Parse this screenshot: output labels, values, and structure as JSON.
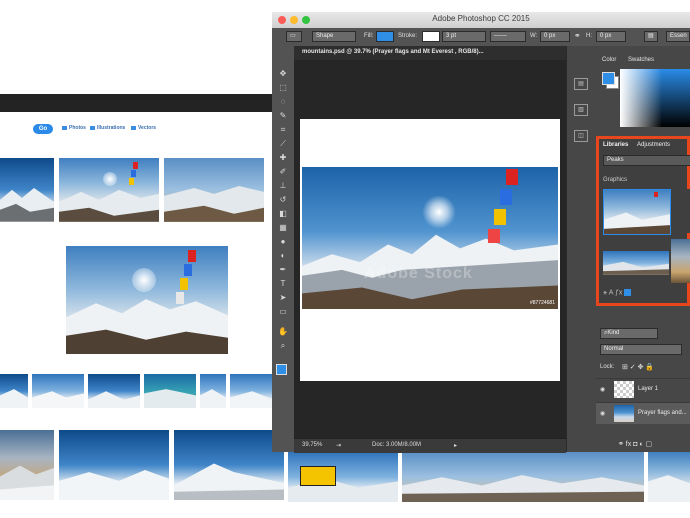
{
  "browser": {
    "go_label": "Go",
    "filters": [
      {
        "label": "Photos"
      },
      {
        "label": "Illustrations"
      },
      {
        "label": "Vectors"
      }
    ]
  },
  "photoshop": {
    "app_title": "Adobe Photoshop CC 2015",
    "options_bar": {
      "shape_mode": "Shape",
      "fill_label": "Fill:",
      "stroke_label": "Stroke:",
      "stroke_width": "3 pt",
      "w_label": "W:",
      "w_value": "0 px",
      "link_icon": "link-icon",
      "h_label": "H:",
      "h_value": "0 px",
      "workspace": "Essen",
      "fill_color": "#2f8fe6"
    },
    "document_tab": "mountains.psd @ 39.7% (Prayer flags and Mt Everest , RGB/8)...",
    "canvas": {
      "watermark": "Adobe Stock",
      "image_id": "#87724681"
    },
    "status": {
      "zoom": "39.75%",
      "doc_size": "Doc: 3.00M/8.00M"
    },
    "panels": {
      "color_tabs": [
        "Color",
        "Swatches"
      ],
      "library_tabs": [
        "Libraries",
        "Adjustments"
      ],
      "library_selected": "Peaks",
      "graphics_label": "Graphics",
      "layers_filter": "Kind",
      "blend_mode": "Normal",
      "lock_label": "Lock:",
      "layers": [
        {
          "name": "Layer 1"
        },
        {
          "name": "Prayer flags and..."
        }
      ],
      "highlight_color": "#e8461d"
    }
  }
}
